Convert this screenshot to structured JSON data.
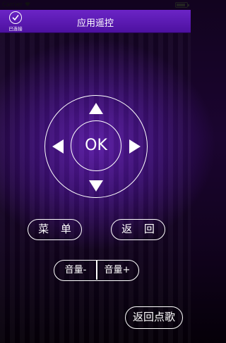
{
  "status_bar": {
    "carrier": "Carrier",
    "time": ""
  },
  "header": {
    "title": "应用遥控",
    "connection_label": "已连接"
  },
  "remote": {
    "ok_label": "OK"
  },
  "buttons": {
    "menu": "菜 单",
    "back": "返 回",
    "volume_down": "音量-",
    "volume_up": "音量+",
    "return_to_song": "返回点歌"
  },
  "colors": {
    "header": "#5a1ab2",
    "background": "#1b0530",
    "accent": "#ffffff"
  }
}
